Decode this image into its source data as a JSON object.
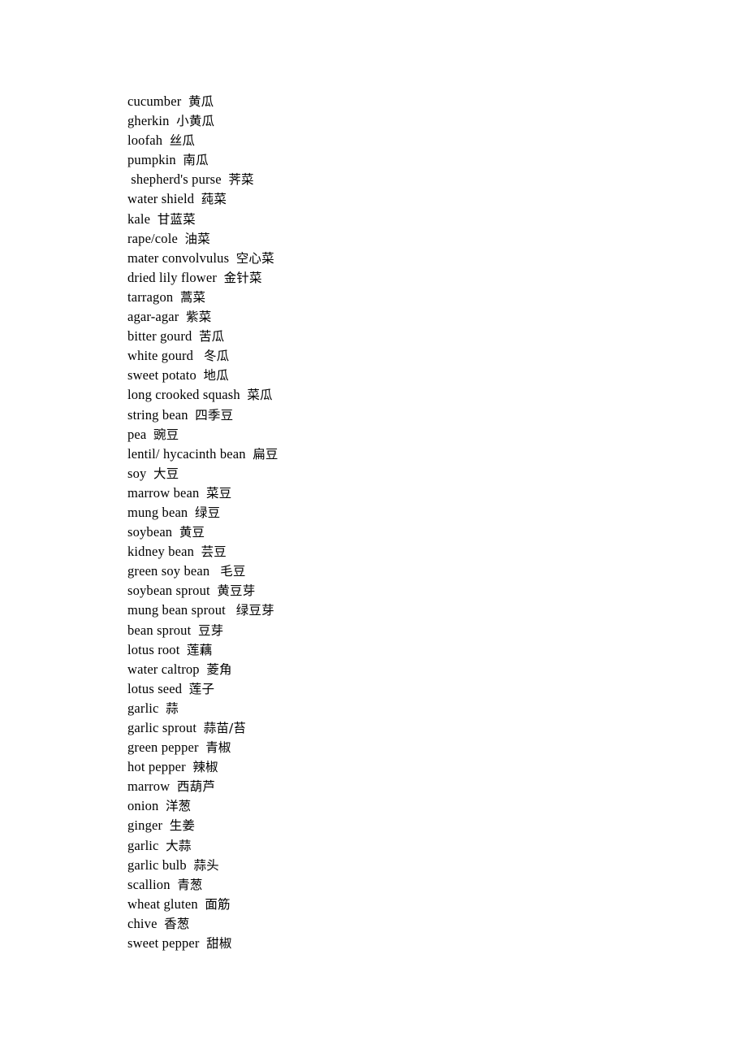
{
  "document": {
    "type": "vocabulary-word-list",
    "language_pair": "English-Chinese",
    "entries": [
      {
        "term": "cucumber",
        "sep": "  ",
        "gloss": "黄瓜"
      },
      {
        "term": "gherkin",
        "sep": "  ",
        "gloss": "小黄瓜"
      },
      {
        "term": "loofah",
        "sep": "  ",
        "gloss": "丝瓜"
      },
      {
        "term": "pumpkin",
        "sep": "  ",
        "gloss": "南瓜"
      },
      {
        "term": " shepherd's purse",
        "sep": "  ",
        "gloss": "荠菜"
      },
      {
        "term": "water shield",
        "sep": "  ",
        "gloss": "莼菜"
      },
      {
        "term": "kale",
        "sep": "  ",
        "gloss": "甘蓝菜"
      },
      {
        "term": "rape/cole",
        "sep": "  ",
        "gloss": "油菜"
      },
      {
        "term": "mater convolvulus",
        "sep": "  ",
        "gloss": "空心菜"
      },
      {
        "term": "dried lily flower",
        "sep": "  ",
        "gloss": "金针菜"
      },
      {
        "term": "tarragon",
        "sep": "  ",
        "gloss": "蒿菜"
      },
      {
        "term": "agar-agar",
        "sep": "  ",
        "gloss": "紫菜"
      },
      {
        "term": "bitter gourd",
        "sep": "  ",
        "gloss": "苦瓜"
      },
      {
        "term": "white gourd",
        "sep": "   ",
        "gloss": "冬瓜"
      },
      {
        "term": "sweet potato",
        "sep": "  ",
        "gloss": "地瓜"
      },
      {
        "term": "long crooked squash",
        "sep": "  ",
        "gloss": "菜瓜"
      },
      {
        "term": "string bean",
        "sep": "  ",
        "gloss": "四季豆"
      },
      {
        "term": "pea",
        "sep": "  ",
        "gloss": "豌豆"
      },
      {
        "term": "lentil/ hycacinth bean",
        "sep": "  ",
        "gloss": "扁豆"
      },
      {
        "term": "soy",
        "sep": "  ",
        "gloss": "大豆"
      },
      {
        "term": "marrow bean",
        "sep": "  ",
        "gloss": "菜豆"
      },
      {
        "term": "mung bean",
        "sep": "  ",
        "gloss": "绿豆"
      },
      {
        "term": "soybean",
        "sep": "  ",
        "gloss": "黄豆"
      },
      {
        "term": "kidney bean",
        "sep": "  ",
        "gloss": "芸豆"
      },
      {
        "term": "green soy bean",
        "sep": "   ",
        "gloss": "毛豆"
      },
      {
        "term": "soybean sprout",
        "sep": "  ",
        "gloss": "黄豆芽"
      },
      {
        "term": "mung bean sprout",
        "sep": "   ",
        "gloss": "绿豆芽"
      },
      {
        "term": "bean sprout",
        "sep": "  ",
        "gloss": "豆芽"
      },
      {
        "term": "lotus root",
        "sep": "  ",
        "gloss": "莲藕"
      },
      {
        "term": "water caltrop",
        "sep": "  ",
        "gloss": "菱角"
      },
      {
        "term": "lotus seed",
        "sep": "  ",
        "gloss": "莲子"
      },
      {
        "term": "garlic",
        "sep": "  ",
        "gloss": "蒜"
      },
      {
        "term": "garlic sprout",
        "sep": "  ",
        "gloss": "蒜苗/苔"
      },
      {
        "term": "green pepper",
        "sep": "  ",
        "gloss": "青椒"
      },
      {
        "term": "hot pepper",
        "sep": "  ",
        "gloss": "辣椒"
      },
      {
        "term": "marrow",
        "sep": "  ",
        "gloss": "西葫芦"
      },
      {
        "term": "onion",
        "sep": "  ",
        "gloss": "洋葱"
      },
      {
        "term": "ginger",
        "sep": "  ",
        "gloss": "生姜"
      },
      {
        "term": "garlic",
        "sep": "  ",
        "gloss": "大蒜"
      },
      {
        "term": "garlic bulb",
        "sep": "  ",
        "gloss": "蒜头"
      },
      {
        "term": "scallion",
        "sep": "  ",
        "gloss": "青葱"
      },
      {
        "term": "wheat gluten",
        "sep": "  ",
        "gloss": "面筋"
      },
      {
        "term": "chive",
        "sep": "  ",
        "gloss": "香葱"
      },
      {
        "term": "sweet pepper",
        "sep": "  ",
        "gloss": "甜椒"
      }
    ]
  }
}
